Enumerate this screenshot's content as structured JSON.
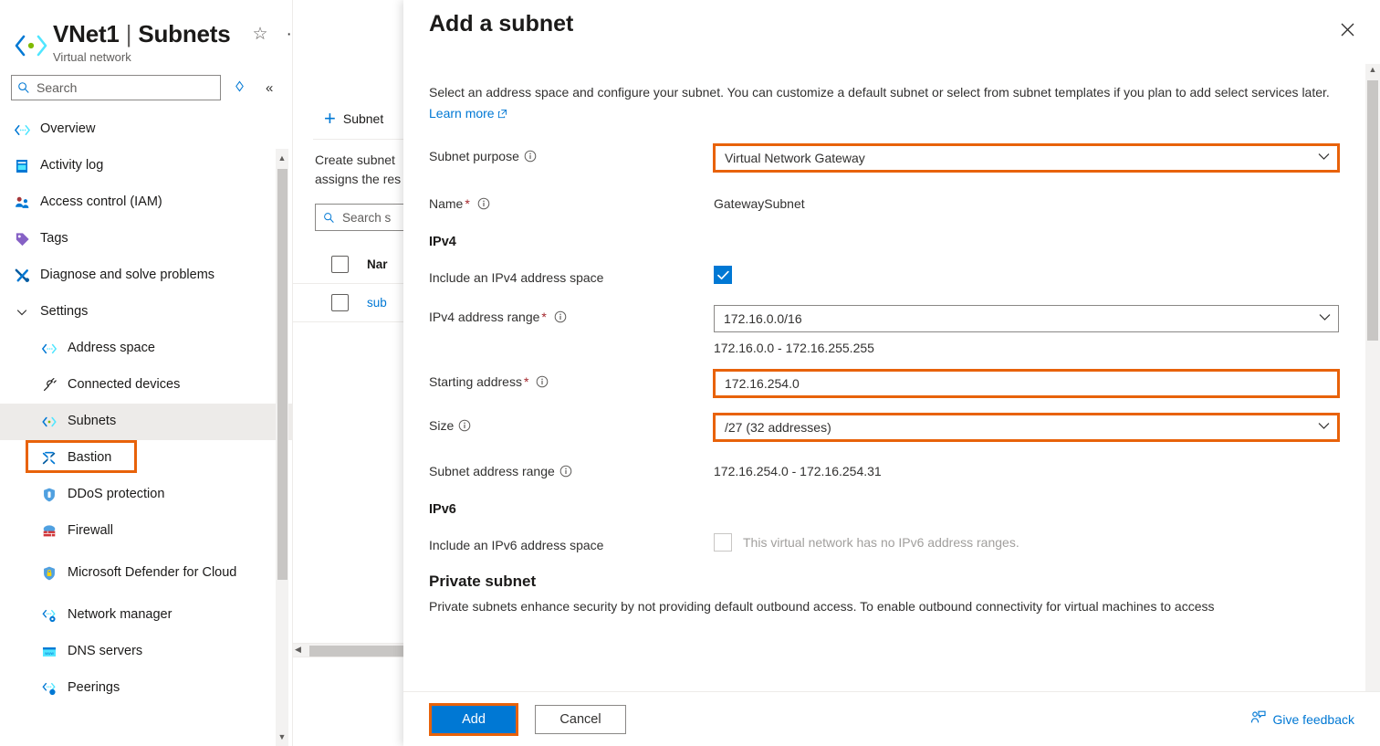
{
  "resource": {
    "name": "VNet1",
    "separator": "|",
    "section": "Subnets",
    "subtitle": "Virtual network",
    "star_icon": "star-icon",
    "more_icon": "ellipsis-icon"
  },
  "sidebar": {
    "search": {
      "placeholder": "Search",
      "icon": "search-icon"
    },
    "pin_icon": "pin-icon",
    "collapse_icon": "collapse-icon",
    "items": [
      {
        "label": "Overview",
        "icon": "overview-icon",
        "level": 0,
        "selected": false
      },
      {
        "label": "Activity log",
        "icon": "activity-log-icon",
        "level": 0,
        "selected": false
      },
      {
        "label": "Access control (IAM)",
        "icon": "access-control-icon",
        "level": 0,
        "selected": false
      },
      {
        "label": "Tags",
        "icon": "tags-icon",
        "level": 0,
        "selected": false
      },
      {
        "label": "Diagnose and solve problems",
        "icon": "diagnose-icon",
        "level": 0,
        "selected": false
      },
      {
        "label": "Settings",
        "icon": "chevron-down-icon",
        "level": 0,
        "selected": false
      },
      {
        "label": "Address space",
        "icon": "address-space-icon",
        "level": 1,
        "selected": false
      },
      {
        "label": "Connected devices",
        "icon": "connected-devices-icon",
        "level": 1,
        "selected": false
      },
      {
        "label": "Subnets",
        "icon": "subnets-icon",
        "level": 1,
        "selected": true
      },
      {
        "label": "Bastion",
        "icon": "bastion-icon",
        "level": 1,
        "selected": false
      },
      {
        "label": "DDoS protection",
        "icon": "ddos-icon",
        "level": 1,
        "selected": false
      },
      {
        "label": "Firewall",
        "icon": "firewall-icon",
        "level": 1,
        "selected": false
      },
      {
        "label": "Microsoft Defender for Cloud",
        "icon": "defender-icon",
        "level": 1,
        "selected": false
      },
      {
        "label": "Network manager",
        "icon": "network-manager-icon",
        "level": 1,
        "selected": false
      },
      {
        "label": "DNS servers",
        "icon": "dns-servers-icon",
        "level": 1,
        "selected": false
      },
      {
        "label": "Peerings",
        "icon": "peerings-icon",
        "level": 1,
        "selected": false
      }
    ]
  },
  "mid_pane": {
    "command_add_label": "Subnet",
    "command_add_icon": "plus-icon",
    "description": "Create subnet\nassigns the res",
    "description_line1": "Create subnet",
    "description_line2": "assigns the res",
    "search": {
      "placeholder": "Search s",
      "icon": "search-icon"
    },
    "table": {
      "columns": [
        "Nar"
      ],
      "rows": [
        [
          "sub"
        ]
      ]
    }
  },
  "panel": {
    "title": "Add a subnet",
    "close_icon": "close-icon",
    "description": "Select an address space and configure your subnet. You can customize a default subnet or select from subnet templates if you plan to add select services later.",
    "learn_more": "Learn more",
    "learn_more_icon": "external-link-icon",
    "fields": {
      "subnet_purpose": {
        "label": "Subnet purpose",
        "value": "Virtual Network Gateway",
        "highlighted": true,
        "info_icon": "info-icon",
        "chevron_icon": "chevron-down-icon"
      },
      "name": {
        "label": "Name",
        "required": "*",
        "value": "GatewaySubnet",
        "info_icon": "info-icon"
      },
      "ipv4_heading": "IPv4",
      "include_ipv4": {
        "label": "Include an IPv4 address space",
        "checked": true,
        "check_icon": "check-icon"
      },
      "ipv4_range": {
        "label": "IPv4 address range",
        "required": "*",
        "value": "172.16.0.0/16",
        "helper": "172.16.0.0 - 172.16.255.255",
        "info_icon": "info-icon",
        "chevron_icon": "chevron-down-icon"
      },
      "starting_address": {
        "label": "Starting address",
        "required": "*",
        "value": "172.16.254.0",
        "highlighted": true,
        "info_icon": "info-icon"
      },
      "size": {
        "label": "Size",
        "value": "/27 (32 addresses)",
        "highlighted": true,
        "info_icon": "info-icon",
        "chevron_icon": "chevron-down-icon"
      },
      "subnet_address_range": {
        "label": "Subnet address range",
        "value": "172.16.254.0 - 172.16.254.31",
        "info_icon": "info-icon"
      },
      "ipv6_heading": "IPv6",
      "include_ipv6": {
        "label": "Include an IPv6 address space",
        "checked": false,
        "disabled_text": "This virtual network has no IPv6 address ranges."
      },
      "private_subnet_heading": "Private subnet",
      "private_subnet_description": "Private subnets enhance security by not providing default outbound access. To enable outbound connectivity for virtual machines to access"
    },
    "footer": {
      "add_label": "Add",
      "add_highlighted": true,
      "cancel_label": "Cancel",
      "feedback_label": "Give feedback",
      "feedback_icon": "feedback-person-icon"
    }
  },
  "colors": {
    "accent": "#0078d4",
    "highlight": "#e8620a",
    "required": "#a4262c",
    "selected_bg": "#edebe9"
  }
}
